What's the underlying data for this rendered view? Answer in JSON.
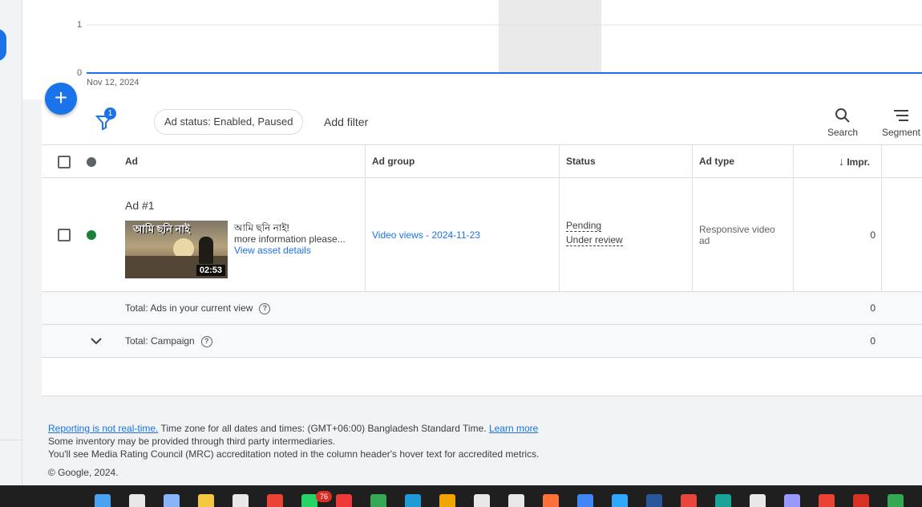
{
  "chart": {
    "y_ticks": [
      "1",
      "0"
    ],
    "date_label": "Nov 12, 2024"
  },
  "chart_data": {
    "type": "line",
    "x": [
      "Nov 12, 2024"
    ],
    "series": [
      {
        "values": [
          0
        ]
      }
    ],
    "ylim": [
      0,
      1
    ],
    "grid": true
  },
  "fab": {
    "label": "+"
  },
  "filter_bar": {
    "filter_count": "1",
    "chip_label": "Ad status: Enabled, Paused",
    "add_filter": "Add filter",
    "search_label": "Search",
    "segment_label": "Segment"
  },
  "table": {
    "headers": {
      "ad": "Ad",
      "ad_group": "Ad group",
      "status": "Status",
      "ad_type": "Ad type",
      "impr": "Impr."
    },
    "row": {
      "title": "Ad #1",
      "thumb_text": "আমি ছনি নাই",
      "duration": "02:53",
      "headline": "আমি ছনি নাই!",
      "description": "more information please...",
      "asset_link": "View asset details",
      "ad_group": "Video views - 2024-11-23",
      "status_1": "Pending",
      "status_2": "Under review",
      "ad_type": "Responsive video ad",
      "impr": "0",
      "status_color": "#188038"
    },
    "total_view": {
      "label": "Total: Ads in your current view",
      "impr": "0"
    },
    "total_campaign": {
      "label": "Total: Campaign",
      "impr": "0"
    }
  },
  "footer": {
    "reporting_link": "Reporting is not real-time.",
    "timezone_text": " Time zone for all dates and times: (GMT+06:00) Bangladesh Standard Time. ",
    "learn_more": "Learn more",
    "line2": "Some inventory may be provided through third party intermediaries.",
    "line3": "You'll see Media Rating Council (MRC) accreditation noted in the column header's hover text for accredited metrics.",
    "copyright": "© Google, 2024."
  },
  "taskbar": {
    "badge": "76",
    "icons": [
      "windows-icon",
      "search-icon",
      "copilot-icon",
      "file-explorer-icon",
      "app-icon",
      "chrome-icon",
      "whatsapp-icon",
      "vivaldi-icon",
      "app-icon",
      "edge-icon",
      "store-icon",
      "terminal-icon",
      "capcut-icon",
      "firefox-icon",
      "app-icon",
      "photoshop-icon",
      "word-icon",
      "app-icon",
      "app-icon",
      "capcut-icon",
      "premiere-icon",
      "chrome-icon",
      "acrobat-icon",
      "chrome-icon"
    ]
  },
  "colors": {
    "accent": "#1a73e8",
    "enabled_dot": "#188038",
    "header_dot": "#5f6368"
  }
}
